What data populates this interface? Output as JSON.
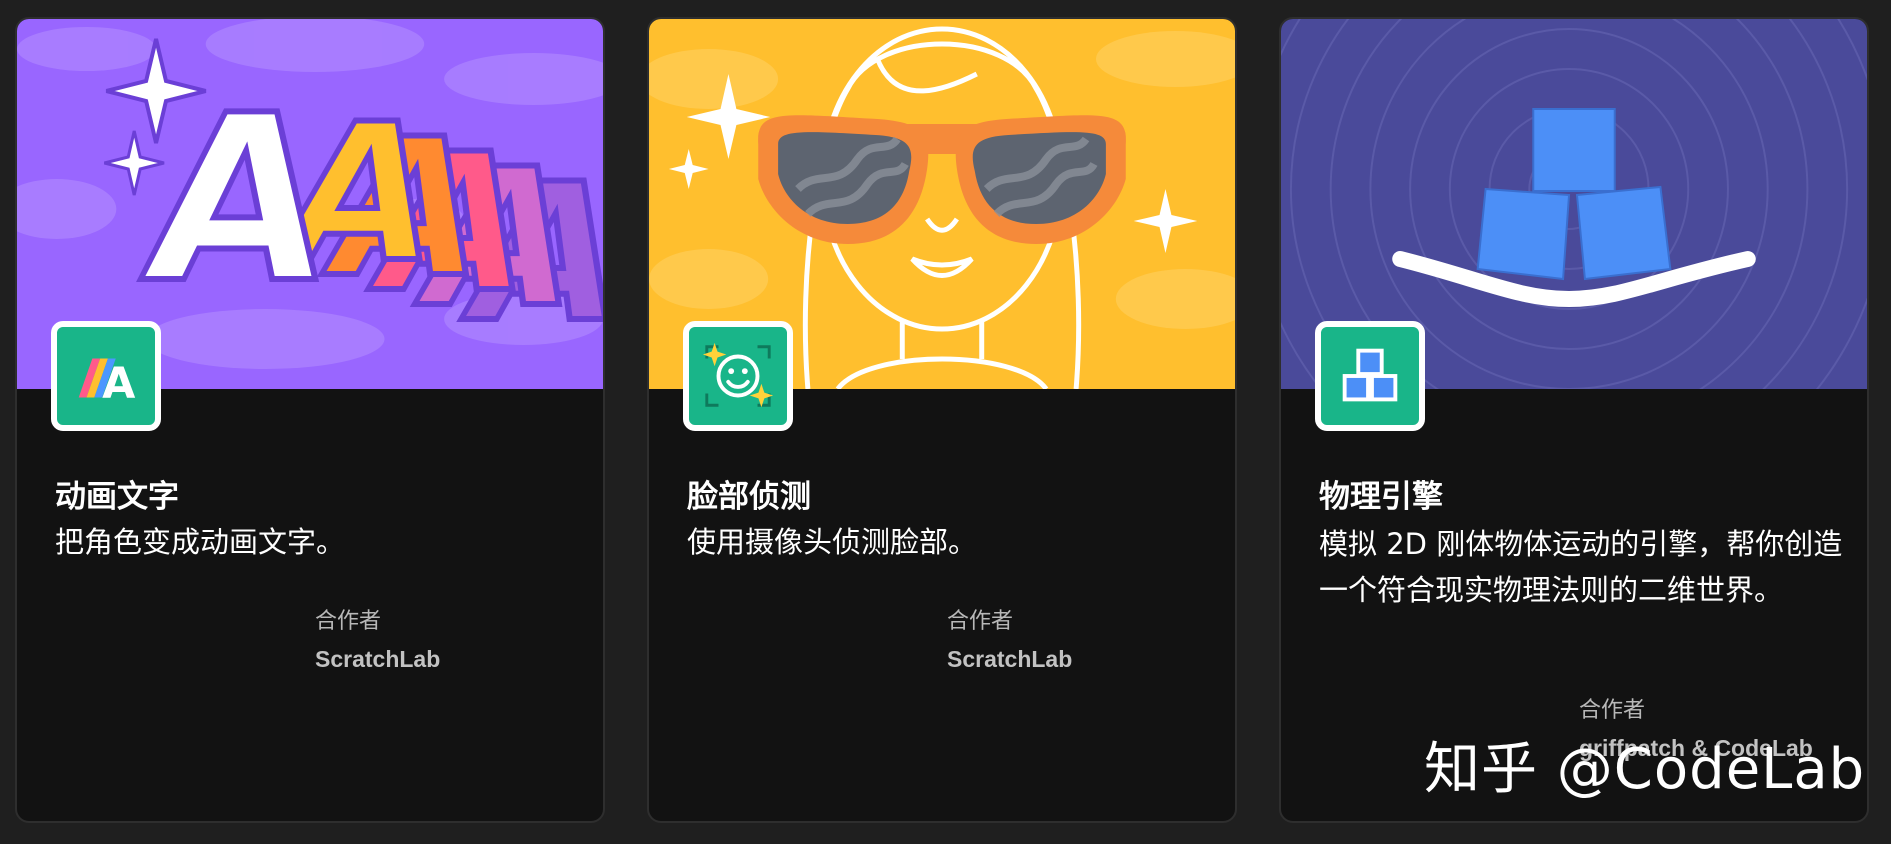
{
  "cards": [
    {
      "title": "动画文字",
      "description": "把角色变成动画文字。",
      "collaborator_label": "合作者",
      "collaborator": "ScratchLab",
      "icon": "animated-text-icon",
      "banner_color": "#9966ff"
    },
    {
      "title": "脸部侦测",
      "description": "使用摄像头侦测脸部。",
      "collaborator_label": "合作者",
      "collaborator": "ScratchLab",
      "icon": "face-sensing-icon",
      "banner_color": "#ffbf2e"
    },
    {
      "title": "物理引擎",
      "description": "模拟 2D 刚体物体运动的引擎，帮你创造一个符合现实物理法则的二维世界。",
      "collaborator_label": "合作者",
      "collaborator": "griffpatch & CodeLab",
      "icon": "physics-blocks-icon",
      "banner_color": "#4a4a9a"
    }
  ],
  "watermark": "知乎 @CodeLab",
  "colors": {
    "background": "#1f1f1f",
    "card": "#121212",
    "icon_tile": "#19b589"
  }
}
